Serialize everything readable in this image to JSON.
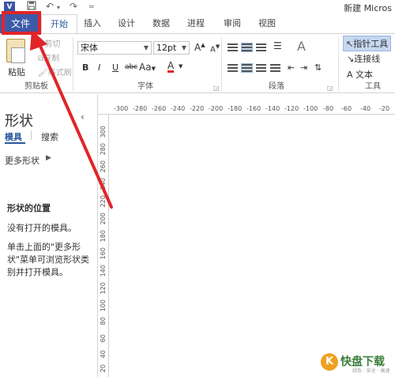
{
  "titlebar": {
    "app_icon": "V",
    "save_icon": "save-icon",
    "undo_glyph": "↶",
    "redo_glyph": "↷",
    "dropdown_glyph": "=",
    "doc_title": "新建 Micros"
  },
  "tabs": [
    "文件",
    "开始",
    "插入",
    "设计",
    "数据",
    "进程",
    "审阅",
    "视图"
  ],
  "ribbon": {
    "clipboard": {
      "paste": "粘贴",
      "cut": "剪切",
      "copy": "复制",
      "format_painter": "格式刷",
      "label": "剪贴板"
    },
    "font": {
      "font_name": "宋体",
      "font_size": "12pt",
      "grow": "A",
      "shrink": "A",
      "bold": "B",
      "italic": "I",
      "underline": "U",
      "strike": "abc",
      "case": "Aa",
      "color": "A",
      "label": "字体"
    },
    "paragraph": {
      "label": "段落"
    },
    "tools": {
      "pointer": "指针工具",
      "connector": "连接线",
      "text": "A 文本",
      "label": "工具"
    }
  },
  "panel": {
    "title": "形状",
    "tab_stencils": "模具",
    "tab_search": "搜索",
    "more_shapes": "更多形状",
    "section_title": "形状的位置",
    "no_stencils": "没有打开的模具。",
    "hint_line1": "单击上面的\"更多形",
    "hint_line2": "状\"菜单可浏览形状类",
    "hint_line3": "别并打开模具。"
  },
  "ruler": {
    "h_ticks": [
      "-300",
      "-280",
      "-260",
      "-240",
      "-220",
      "-200",
      "-180",
      "-160",
      "-140",
      "-120",
      "-100",
      "-80",
      "-60",
      "-40",
      "-20"
    ],
    "v_ticks": [
      "300",
      "280",
      "260",
      "240",
      "220",
      "200",
      "180",
      "160",
      "140",
      "120",
      "100",
      "80",
      "60",
      "40",
      "20"
    ]
  },
  "watermark": {
    "logo": "K",
    "text": "快盘下载",
    "sub": "绿色 · 安全 · 高速"
  },
  "colors": {
    "file_tab": "#3c5ba8",
    "highlight_red": "#e0242a",
    "accent_blue": "#2b579a"
  }
}
